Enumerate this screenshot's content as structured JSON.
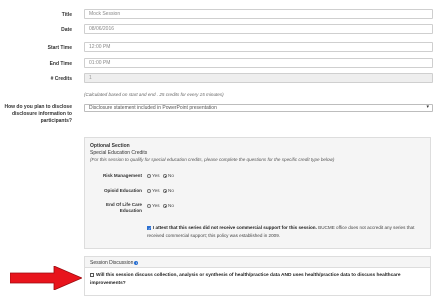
{
  "form": {
    "title": {
      "label": "Title",
      "value": "Mock Session"
    },
    "date": {
      "label": "Date",
      "value": "08/06/2016"
    },
    "start_time": {
      "label": "Start Time",
      "value": "12:00 PM"
    },
    "end_time": {
      "label": "End Time",
      "value": "01:00 PM"
    },
    "credits": {
      "label": "# Credits",
      "value": "1"
    },
    "credits_note": "(Calculated based on start and end . 25 credits for every 15 minutes)",
    "disclosure": {
      "label": "How do you plan to disclose disclosure information to participants?",
      "selected": "Disclosure statement included in PowerPoint presentation"
    }
  },
  "optional_section": {
    "heading": "Optional Section",
    "subheading": "Special Education Credits",
    "note": "(For this session to qualify for special education credits, please complete the questions for the specific credit type below)",
    "questions": [
      {
        "label": "Risk Management",
        "yes": "Yes",
        "no": "No",
        "selected": "No"
      },
      {
        "label": "Opioid Education",
        "yes": "Yes",
        "no": "No",
        "selected": "No"
      },
      {
        "label": "End Of Life Care Education",
        "yes": "Yes",
        "no": "No",
        "selected": "No"
      }
    ],
    "attest_bold": "I attest that this series did not receive commercial support for this session.",
    "attest_rest": " BUCME office does not accredit any series that received commercial support; this policy was established in 2009."
  },
  "session_discussion": {
    "heading": "Session Discussion",
    "info_icon": "i",
    "question": "Will this session discuss collection, analysis or synthesis of health/practice data AND uses health/practice data to discuss healthcare improvements?"
  },
  "colors": {
    "arrow": "#e8141c",
    "accent": "#2a6fd1"
  }
}
